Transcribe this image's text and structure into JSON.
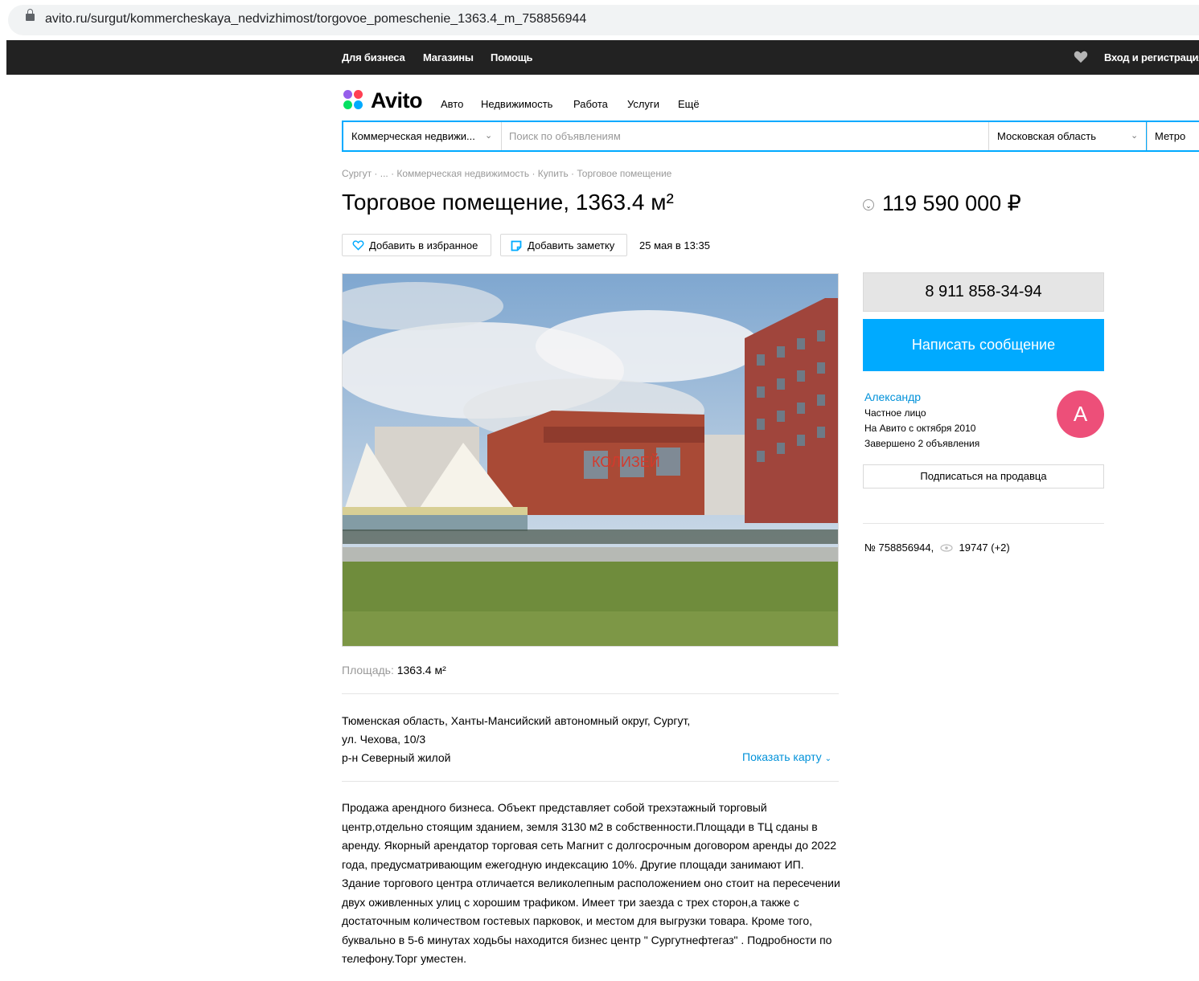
{
  "browser": {
    "url": "avito.ru/surgut/kommercheskaya_nedvizhimost/torgovoe_pomeschenie_1363.4_m_758856944"
  },
  "topnav": {
    "business": "Для бизнеса",
    "shops": "Магазины",
    "help": "Помощь",
    "login": "Вход и регистрация"
  },
  "logo": {
    "text": "Avito"
  },
  "mainnav": [
    "Авто",
    "Недвижимость",
    "Работа",
    "Услуги",
    "Ещё"
  ],
  "search": {
    "category": "Коммерческая недвижи...",
    "placeholder": "Поиск по объявлениям",
    "region": "Московская область",
    "metro": "Метро"
  },
  "breadcrumbs": "Сургут · ... · Коммерческая недвижимость · Купить · Торговое помещение",
  "listing": {
    "title": "Торговое помещение, 1363.4 м²",
    "price": "119 590 000 ₽",
    "favorite_label": "Добавить в избранное",
    "note_label": "Добавить заметку",
    "date": "25 мая в 13:35",
    "sign_text": "КОЛИЗЕЙ",
    "area_key": "Площадь:",
    "area_value": "1363.4 м²",
    "address_line1": "Тюменская область, Ханты-Мансийский автономный округ, Сургут,",
    "address_line2": "ул. Чехова, 10/3",
    "district": "р-н Северный жилой",
    "show_map": "Показать карту",
    "description": "Продажа арендного бизнеса. Объект представляет собой трехэтажный торговый центр,отдельно стоящим зданием, земля 3130 м2 в собственности.Площади в ТЦ сданы в аренду. Якорный арендатор торговая сеть Магнит с долгосрочным договором аренды до 2022 года, предусматривающим ежегодную индексацию 10%. Другие площади занимают ИП. Здание торгового центра отличается великолепным расположением оно стоит на пересечении двух оживленных улиц с хорошим трафиком. Имеет три заезда с трех сторон,а также с достаточным количеством гостевых парковок, и местом для выгрузки товара. Кроме того, буквально в 5-6 минутах ходьбы находится бизнес центр \" Сургутнефтегаз\" . Подробности по телефону.Торг уместен."
  },
  "seller": {
    "phone": "8 911 858-34-94",
    "message_label": "Написать сообщение",
    "name": "Александр",
    "type": "Частное лицо",
    "since": "На Авито с октября 2010",
    "completed": "Завершено 2 объявления",
    "avatar_letter": "А",
    "subscribe_label": "Подписаться на продавца"
  },
  "stats": {
    "id": "№ 758856944,",
    "views": "19747 (+2)"
  },
  "colors": {
    "accent": "#00aaff",
    "link": "#0091d9",
    "avatar": "#ed4f79",
    "topbar": "#222222"
  }
}
